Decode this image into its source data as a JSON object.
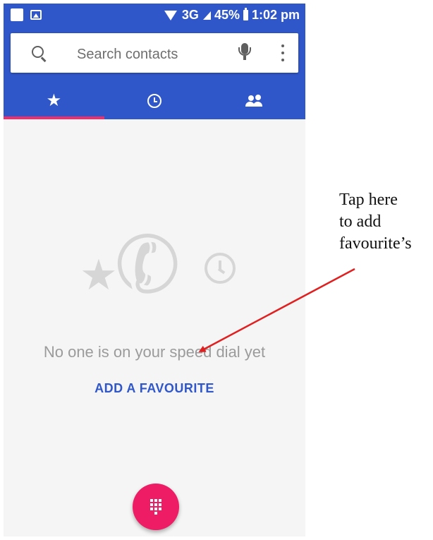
{
  "status_bar": {
    "network": "3G",
    "battery": "45%",
    "time": "1:02 pm"
  },
  "search": {
    "placeholder": "Search contacts"
  },
  "tabs": [
    {
      "icon": "star-icon",
      "active": true
    },
    {
      "icon": "clock-icon",
      "active": false
    },
    {
      "icon": "people-icon",
      "active": false
    }
  ],
  "empty_state": {
    "message": "No one is on your speed dial yet",
    "action_label": "ADD A FAVOURITE"
  },
  "fab": {
    "icon": "dialpad-icon"
  },
  "annotation": {
    "line1": "Tap here",
    "line2": "to add",
    "line3": "favourite’s"
  },
  "colors": {
    "primary": "#3057c9",
    "accent": "#ee1b65",
    "tab_indicator": "#ee2f6e",
    "arrow": "#e02020"
  }
}
